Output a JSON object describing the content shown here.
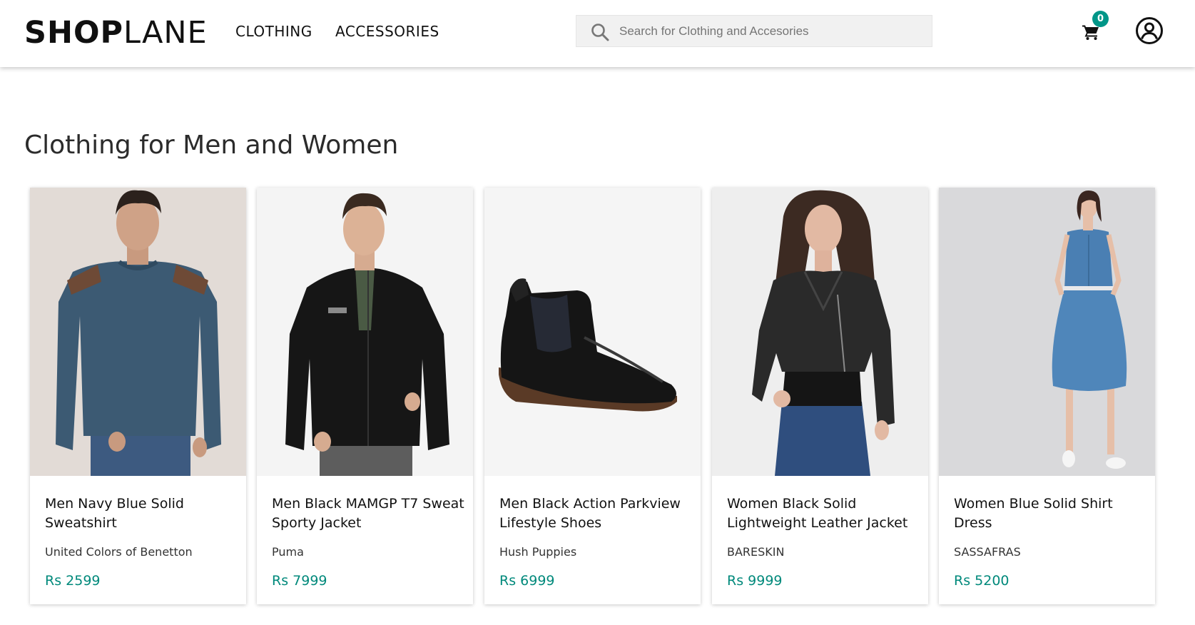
{
  "header": {
    "logo_bold": "SHOP",
    "logo_light": "LANE",
    "nav": [
      {
        "label": "CLOTHING"
      },
      {
        "label": "ACCESSORIES"
      }
    ],
    "search": {
      "placeholder": "Search for Clothing and Accesories",
      "value": "",
      "icon": "search-icon"
    },
    "cart": {
      "icon": "shopping-cart-icon",
      "count": "0"
    },
    "account": {
      "icon": "user-circle-icon"
    }
  },
  "section": {
    "title": "Clothing for Men and Women"
  },
  "products": [
    {
      "name": "Men Navy Blue Solid Sweatshirt",
      "brand": "United Colors of Benetton",
      "price": "Rs 2599"
    },
    {
      "name": "Men Black MAMGP T7 Sweat Sporty Jacket",
      "brand": "Puma",
      "price": "Rs 7999"
    },
    {
      "name": "Men Black Action Parkview Lifestyle Shoes",
      "brand": "Hush Puppies",
      "price": "Rs 6999"
    },
    {
      "name": "Women Black Solid Lightweight Leather Jacket",
      "brand": "BARESKIN",
      "price": "Rs 9999"
    },
    {
      "name": "Women Blue Solid Shirt Dress",
      "brand": "SASSAFRAS",
      "price": "Rs 5200"
    }
  ],
  "colors": {
    "accent": "#009688",
    "price": "#00897b",
    "search_bg": "#f1f1f1"
  }
}
